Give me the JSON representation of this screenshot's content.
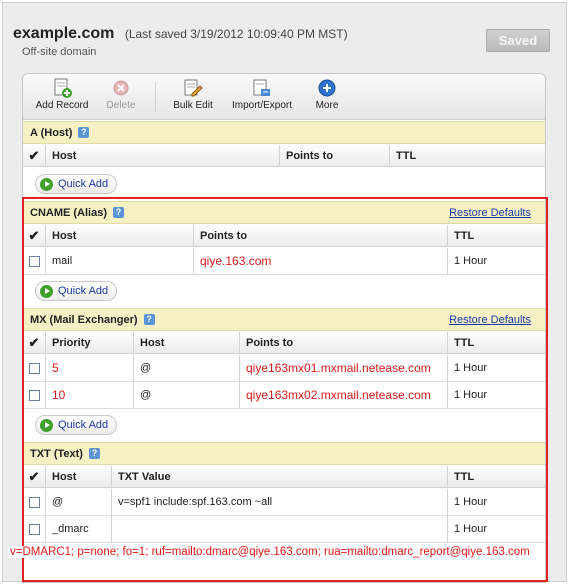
{
  "header": {
    "domain": "example.com",
    "last_saved": "(Last saved 3/19/2012 10:09:40 PM MST)",
    "subtitle": "Off-site domain",
    "saved_button": "Saved"
  },
  "toolbar": {
    "add_record": "Add Record",
    "delete": "Delete",
    "bulk_edit": "Bulk Edit",
    "import_export": "Import/Export",
    "more": "More"
  },
  "quick_add_label": "Quick Add",
  "restore_defaults": "Restore Defaults",
  "a_section": {
    "title": "A (Host)",
    "columns": [
      "Host",
      "Points to",
      "TTL"
    ]
  },
  "cname_section": {
    "title": "CNAME (Alias)",
    "columns": [
      "Host",
      "Points to",
      "TTL"
    ],
    "rows": [
      {
        "host": "mail",
        "points_to": "qiye.163.com",
        "ttl": "1 Hour"
      }
    ]
  },
  "mx_section": {
    "title": "MX (Mail Exchanger)",
    "columns": [
      "Priority",
      "Host",
      "Points to",
      "TTL"
    ],
    "rows": [
      {
        "priority": "5",
        "host": "@",
        "points_to": "qiye163mx01.mxmail.netease.com",
        "ttl": "1 Hour"
      },
      {
        "priority": "10",
        "host": "@",
        "points_to": "qiye163mx02.mxmail.netease.com",
        "ttl": "1 Hour"
      }
    ]
  },
  "txt_section": {
    "title": "TXT (Text)",
    "columns": [
      "Host",
      "TXT Value",
      "TTL"
    ],
    "rows": [
      {
        "host": "@",
        "value": "v=spf1 include:spf.163.com  ~all",
        "ttl": "1 Hour"
      },
      {
        "host": "_dmarc",
        "value": "",
        "ttl": "1 Hour"
      }
    ]
  },
  "overlay_note": "v=DMARC1; p=none; fo=1; ruf=mailto:dmarc@qiye.163.com; rua=mailto:dmarc_report@qiye.163.com",
  "colors": {
    "accent_red": "#e02222",
    "section_yellow": "#f6f1c5",
    "link_blue": "#1a3aa8"
  }
}
